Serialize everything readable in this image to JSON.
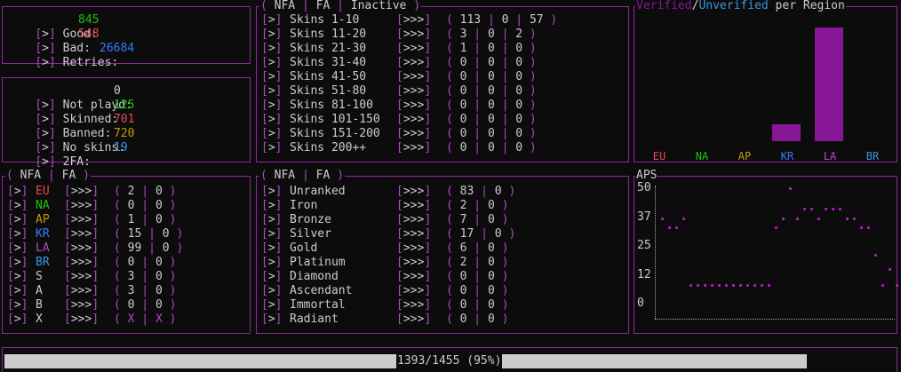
{
  "stats": {
    "good": {
      "label": "Good:",
      "value": "845"
    },
    "bad": {
      "label": "Bad:",
      "value": "548"
    },
    "retries": {
      "label": "Retries:",
      "value": "26684"
    }
  },
  "accounts": {
    "not_played": {
      "label": "Not playd:",
      "value": "0"
    },
    "skinned": {
      "label": "Skinned:",
      "value": "125"
    },
    "banned": {
      "label": "Banned:",
      "value": "701"
    },
    "no_skins": {
      "label": "No skins:",
      "value": "720"
    },
    "twofa": {
      "label": "2FA:",
      "value": "19"
    }
  },
  "skins_panel": {
    "title": {
      "nfa": "NFA",
      "fa": "FA",
      "inactive": "Inactive"
    },
    "rows": [
      {
        "label": "Skins 1-10",
        "nfa": "113",
        "fa": "0",
        "inactive": "57"
      },
      {
        "label": "Skins 11-20",
        "nfa": "3",
        "fa": "0",
        "inactive": "2"
      },
      {
        "label": "Skins 21-30",
        "nfa": "1",
        "fa": "0",
        "inactive": "0"
      },
      {
        "label": "Skins 31-40",
        "nfa": "0",
        "fa": "0",
        "inactive": "0"
      },
      {
        "label": "Skins 41-50",
        "nfa": "0",
        "fa": "0",
        "inactive": "0"
      },
      {
        "label": "Skins 51-80",
        "nfa": "0",
        "fa": "0",
        "inactive": "0"
      },
      {
        "label": "Skins 81-100",
        "nfa": "0",
        "fa": "0",
        "inactive": "0"
      },
      {
        "label": "Skins 101-150",
        "nfa": "0",
        "fa": "0",
        "inactive": "0"
      },
      {
        "label": "Skins 151-200",
        "nfa": "0",
        "fa": "0",
        "inactive": "0"
      },
      {
        "label": "Skins 200++",
        "nfa": "0",
        "fa": "0",
        "inactive": "0"
      }
    ]
  },
  "region_panel": {
    "title": {
      "nfa": "NFA",
      "fa": "FA"
    },
    "rows": [
      {
        "label": "EU",
        "nfa": "2",
        "fa": "0",
        "color": "#e74856"
      },
      {
        "label": "NA",
        "nfa": "0",
        "fa": "0",
        "color": "#16c60c"
      },
      {
        "label": "AP",
        "nfa": "1",
        "fa": "0",
        "color": "#c19c00"
      },
      {
        "label": "KR",
        "nfa": "15",
        "fa": "0",
        "color": "#3b78ff"
      },
      {
        "label": "LA",
        "nfa": "99",
        "fa": "0",
        "color": "#b148c6"
      },
      {
        "label": "BR",
        "nfa": "0",
        "fa": "0",
        "color": "#3a96dd"
      },
      {
        "label": "S",
        "nfa": "3",
        "fa": "0",
        "color": "#cccccc"
      },
      {
        "label": "A",
        "nfa": "3",
        "fa": "0",
        "color": "#cccccc"
      },
      {
        "label": "B",
        "nfa": "0",
        "fa": "0",
        "color": "#cccccc"
      },
      {
        "label": "X",
        "nfa": "X",
        "fa": "X",
        "color": "#cccccc"
      }
    ]
  },
  "rank_panel": {
    "title": {
      "nfa": "NFA",
      "fa": "FA"
    },
    "rows": [
      {
        "label": "Unranked",
        "nfa": "83",
        "fa": "0"
      },
      {
        "label": "Iron",
        "nfa": "2",
        "fa": "0"
      },
      {
        "label": "Bronze",
        "nfa": "7",
        "fa": "0"
      },
      {
        "label": "Silver",
        "nfa": "17",
        "fa": "0"
      },
      {
        "label": "Gold",
        "nfa": "6",
        "fa": "0"
      },
      {
        "label": "Platinum",
        "nfa": "2",
        "fa": "0"
      },
      {
        "label": "Diamond",
        "nfa": "0",
        "fa": "0"
      },
      {
        "label": "Ascendant",
        "nfa": "0",
        "fa": "0"
      },
      {
        "label": "Immortal",
        "nfa": "0",
        "fa": "0"
      },
      {
        "label": "Radiant",
        "nfa": "0",
        "fa": "0"
      }
    ]
  },
  "region_chart": {
    "title": {
      "verified": "Verified",
      "slash": "/",
      "unverified": "Unverified",
      "rest": " per Region"
    },
    "chart_data": {
      "type": "bar",
      "categories": [
        "EU",
        "NA",
        "AP",
        "KR",
        "LA",
        "BR"
      ],
      "values": [
        0,
        0,
        0,
        15,
        99,
        0
      ],
      "category_colors": [
        "#e74856",
        "#16c60c",
        "#c19c00",
        "#3b78ff",
        "#b148c6",
        "#3a96dd"
      ],
      "bar_color": "#881798",
      "ylim": [
        0,
        99
      ]
    }
  },
  "aps_chart": {
    "title": "APS",
    "chart_data": {
      "type": "scatter",
      "y_ticks": [
        "50",
        "37",
        "25",
        "12",
        "0"
      ],
      "ylim": [
        0,
        50
      ],
      "values": [
        37,
        33,
        33,
        37,
        8,
        8,
        8,
        8,
        8,
        8,
        8,
        8,
        8,
        8,
        8,
        8,
        33,
        37,
        50,
        37,
        41,
        41,
        37,
        41,
        41,
        41,
        37,
        37,
        33,
        33,
        21,
        8,
        15,
        8,
        8,
        8
      ],
      "point_color": "#b41ec3"
    }
  },
  "progress": {
    "text": "1393/1455 (95%)",
    "fraction": 0.957
  },
  "symbols": {
    "prompt": ">",
    "arrows": ">>>",
    "sep": "|"
  }
}
